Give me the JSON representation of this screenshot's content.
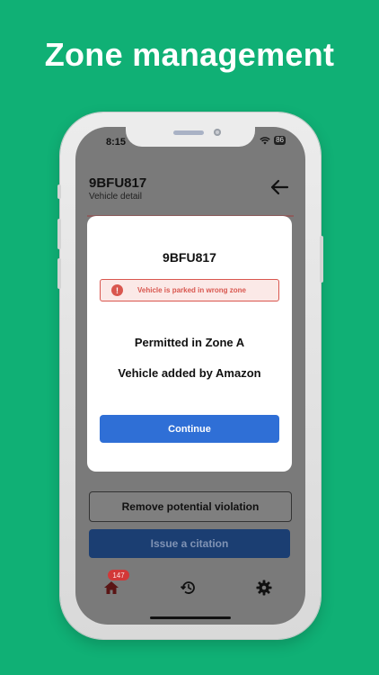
{
  "headline": "Zone management",
  "status_bar": {
    "time": "8:15",
    "battery": "86"
  },
  "header": {
    "plate": "9BFU817",
    "subtitle": "Vehicle detail"
  },
  "modal": {
    "title": "9BFU817",
    "alert": {
      "text": "Vehicle is parked in wrong zone",
      "icon": "exclamation-icon"
    },
    "line1": "Permitted in Zone A",
    "line2": "Vehicle added by Amazon",
    "continue_label": "Continue"
  },
  "actions": {
    "remove_label": "Remove potential violation",
    "issue_label": "Issue a citation"
  },
  "tabbar": {
    "home_badge": "147",
    "tabs": [
      {
        "name": "home",
        "icon": "home-icon"
      },
      {
        "name": "history",
        "icon": "history-icon"
      },
      {
        "name": "settings",
        "icon": "gear-icon"
      }
    ]
  },
  "colors": {
    "background": "#10b075",
    "primary": "#2f6fd6",
    "alert": "#d9574f",
    "badge": "#d23838"
  }
}
